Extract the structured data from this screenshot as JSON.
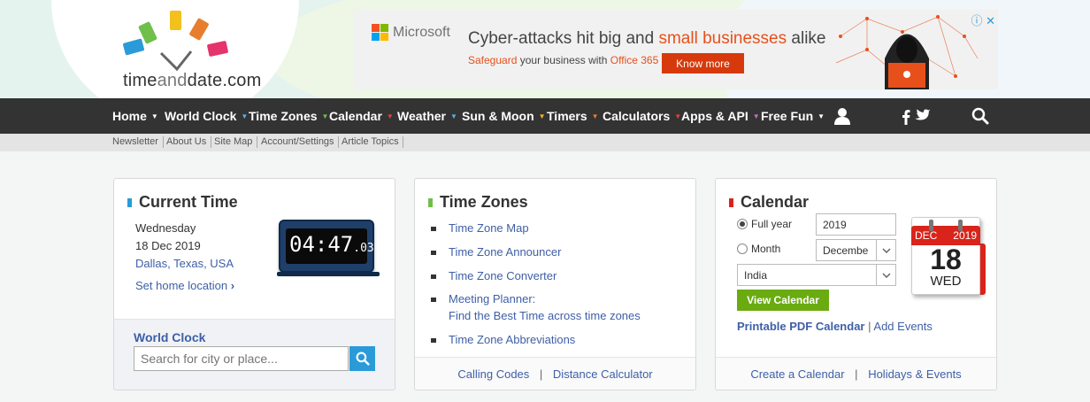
{
  "logo": {
    "text_a": "time",
    "text_b": "and",
    "text_c": "date",
    "text_d": ".com"
  },
  "ad": {
    "brand": "Microsoft",
    "headline_a": "Cyber-attacks hit big and ",
    "headline_b": "small businesses",
    "headline_c": " alike",
    "sub_a": "Safeguard",
    "sub_b": " your business with ",
    "sub_c": "Office 365",
    "button": "Know more",
    "colors": {
      "brand_red": "#f25022",
      "brand_green": "#7fba00",
      "brand_blue": "#00a4ef",
      "brand_yellow": "#ffb900",
      "accent": "#e8501b"
    }
  },
  "nav": {
    "items": [
      {
        "label": "Home",
        "arrow_color": "#ffffff"
      },
      {
        "label": "World Clock",
        "arrow_color": "#55b3e0"
      },
      {
        "label": "Time Zones",
        "arrow_color": "#6fbf4a"
      },
      {
        "label": "Calendar",
        "arrow_color": "#e0443a"
      },
      {
        "label": "Weather",
        "arrow_color": "#55b3e0"
      },
      {
        "label": "Sun & Moon",
        "arrow_color": "#f3b722"
      },
      {
        "label": "Timers",
        "arrow_color": "#e77e2e"
      },
      {
        "label": "Calculators",
        "arrow_color": "#e0443a"
      },
      {
        "label": "Apps & API",
        "arrow_color": "#c070c8"
      },
      {
        "label": "Free Fun",
        "arrow_color": "#ffffff"
      }
    ],
    "icons": [
      "user-icon",
      "facebook-icon",
      "twitter-icon",
      "search-icon"
    ]
  },
  "subnav": [
    "Newsletter",
    "About Us",
    "Site Map",
    "Account/Settings",
    "Article Topics"
  ],
  "current_time": {
    "title": "Current Time",
    "weekday": "Wednesday",
    "date": "18 Dec 2019",
    "location": "Dallas, Texas, USA",
    "set_home": "Set home location",
    "clock_main": "04:47",
    "clock_sec": ".03",
    "world_clock_label": "World Clock",
    "search_placeholder": "Search for city or place...",
    "accent": "#2a9bd8"
  },
  "time_zones": {
    "title": "Time Zones",
    "links": [
      "Time Zone Map",
      "Time Zone Announcer",
      "Time Zone Converter"
    ],
    "meeting_1": "Meeting Planner:",
    "meeting_2": "Find the Best Time across time zones",
    "abbrev": "Time Zone Abbreviations",
    "foot_a": "Calling Codes",
    "foot_sep": "|",
    "foot_b": "Distance Calculator",
    "accent": "#6fbf4a"
  },
  "calendar": {
    "title": "Calendar",
    "full_year_label": "Full year",
    "year_value": "2019",
    "month_label": "Month",
    "month_value": "Decembe",
    "country_value": "India",
    "view_button": "View Calendar",
    "printable": "Printable PDF Calendar",
    "sep": "|",
    "add_events": "Add Events",
    "icon_month": "DEC",
    "icon_year": "2019",
    "icon_day": "18",
    "icon_weekday": "WED",
    "foot_a": "Create a Calendar",
    "foot_sep": "|",
    "foot_b": "Holidays & Events",
    "accent": "#d9241b",
    "button_color": "#6aab11"
  }
}
